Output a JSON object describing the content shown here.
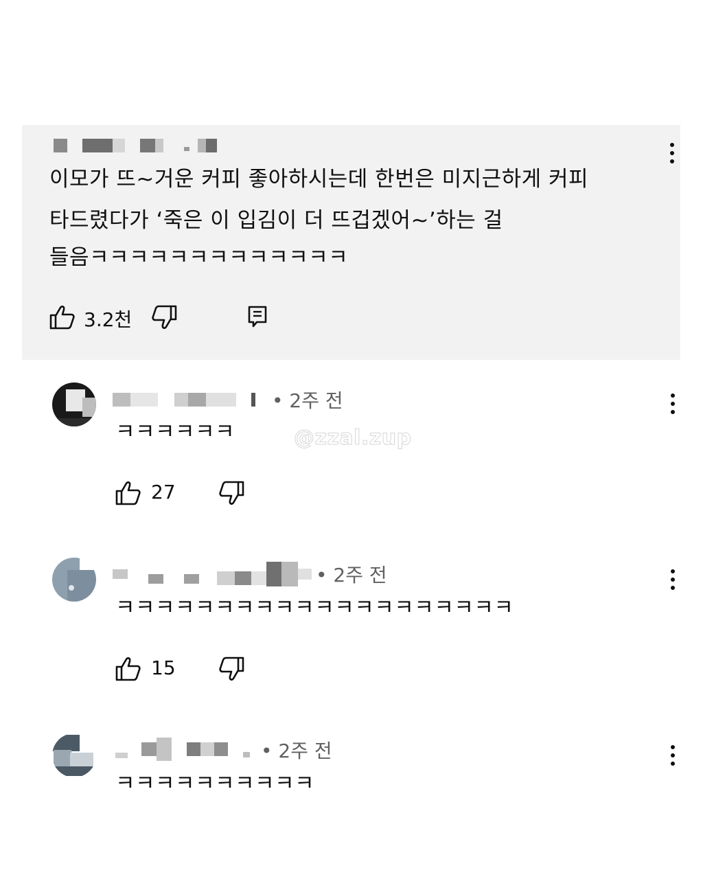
{
  "main_comment": {
    "text_lines": [
      "이모가 뜨~거운 커피 좋아하시는데 한번은 미지근하게 커피",
      "타드렸다가 ‘죽은 이 입김이 더 뜨겁겠어~’하는 걸",
      "들음ㅋㅋㅋㅋㅋㅋㅋㅋㅋㅋㅋㅋㅋ"
    ],
    "likes": "3.2천"
  },
  "replies": [
    {
      "time": "• 2주 전",
      "text": "ㅋㅋㅋㅋㅋㅋ",
      "likes": "27"
    },
    {
      "time": "• 2주 전",
      "text": "ㅋㅋㅋㅋㅋㅋㅋㅋㅋㅋㅋㅋㅋㅋㅋㅋㅋㅋㅋㅋ",
      "likes": "15"
    },
    {
      "time": "• 2주 전",
      "text": "ㅋㅋㅋㅋㅋㅋㅋㅋㅋㅋ"
    }
  ],
  "watermark": "@zzal.zup",
  "icons": {
    "like": "thumbs-up-icon",
    "dislike": "thumbs-down-icon",
    "reply": "reply-icon",
    "more": "more-vert-icon"
  }
}
